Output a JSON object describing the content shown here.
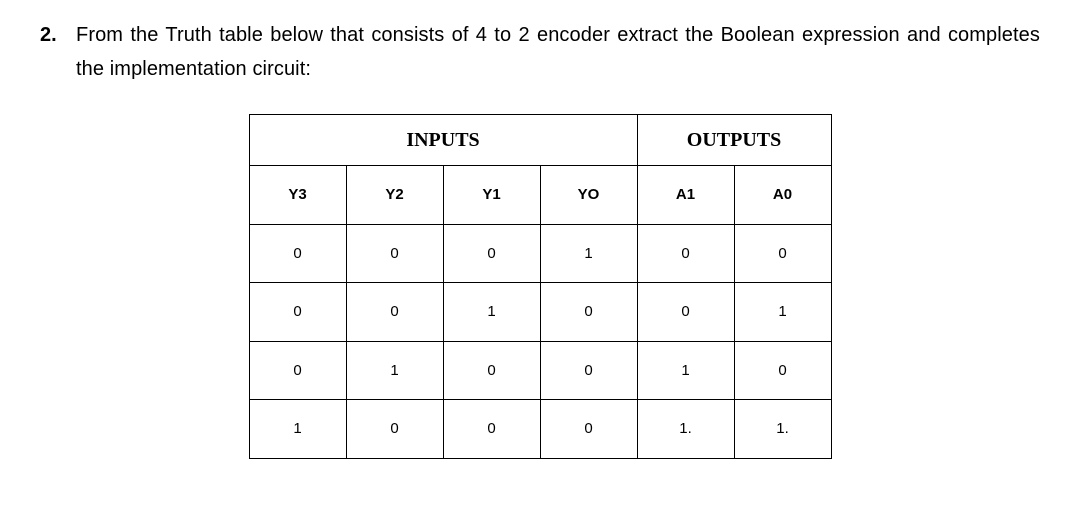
{
  "question": {
    "number": "2.",
    "text": "From the Truth table below that consists of 4 to 2 encoder extract the Boolean expression and completes the implementation circuit:"
  },
  "table": {
    "sections": {
      "inputs": "INPUTS",
      "outputs": "OUTPUTS"
    },
    "columns": {
      "y3": "Y3",
      "y2": "Y2",
      "y1": "Y1",
      "y0": "YO",
      "a1": "A1",
      "a0": "A0"
    },
    "rows": [
      {
        "y3": "0",
        "y2": "0",
        "y1": "0",
        "y0": "1",
        "a1": "0",
        "a0": "0"
      },
      {
        "y3": "0",
        "y2": "0",
        "y1": "1",
        "y0": "0",
        "a1": "0",
        "a0": "1"
      },
      {
        "y3": "0",
        "y2": "1",
        "y1": "0",
        "y0": "0",
        "a1": "1",
        "a0": "0"
      },
      {
        "y3": "1",
        "y2": "0",
        "y1": "0",
        "y0": "0",
        "a1": "1.",
        "a0": "1."
      }
    ]
  },
  "chart_data": {
    "type": "table",
    "title": "4 to 2 encoder truth table",
    "input_columns": [
      "Y3",
      "Y2",
      "Y1",
      "Y0"
    ],
    "output_columns": [
      "A1",
      "A0"
    ],
    "rows": [
      {
        "Y3": 0,
        "Y2": 0,
        "Y1": 0,
        "Y0": 1,
        "A1": 0,
        "A0": 0
      },
      {
        "Y3": 0,
        "Y2": 0,
        "Y1": 1,
        "Y0": 0,
        "A1": 0,
        "A0": 1
      },
      {
        "Y3": 0,
        "Y2": 1,
        "Y1": 0,
        "Y0": 0,
        "A1": 1,
        "A0": 0
      },
      {
        "Y3": 1,
        "Y2": 0,
        "Y1": 0,
        "Y0": 0,
        "A1": 1,
        "A0": 1
      }
    ]
  }
}
